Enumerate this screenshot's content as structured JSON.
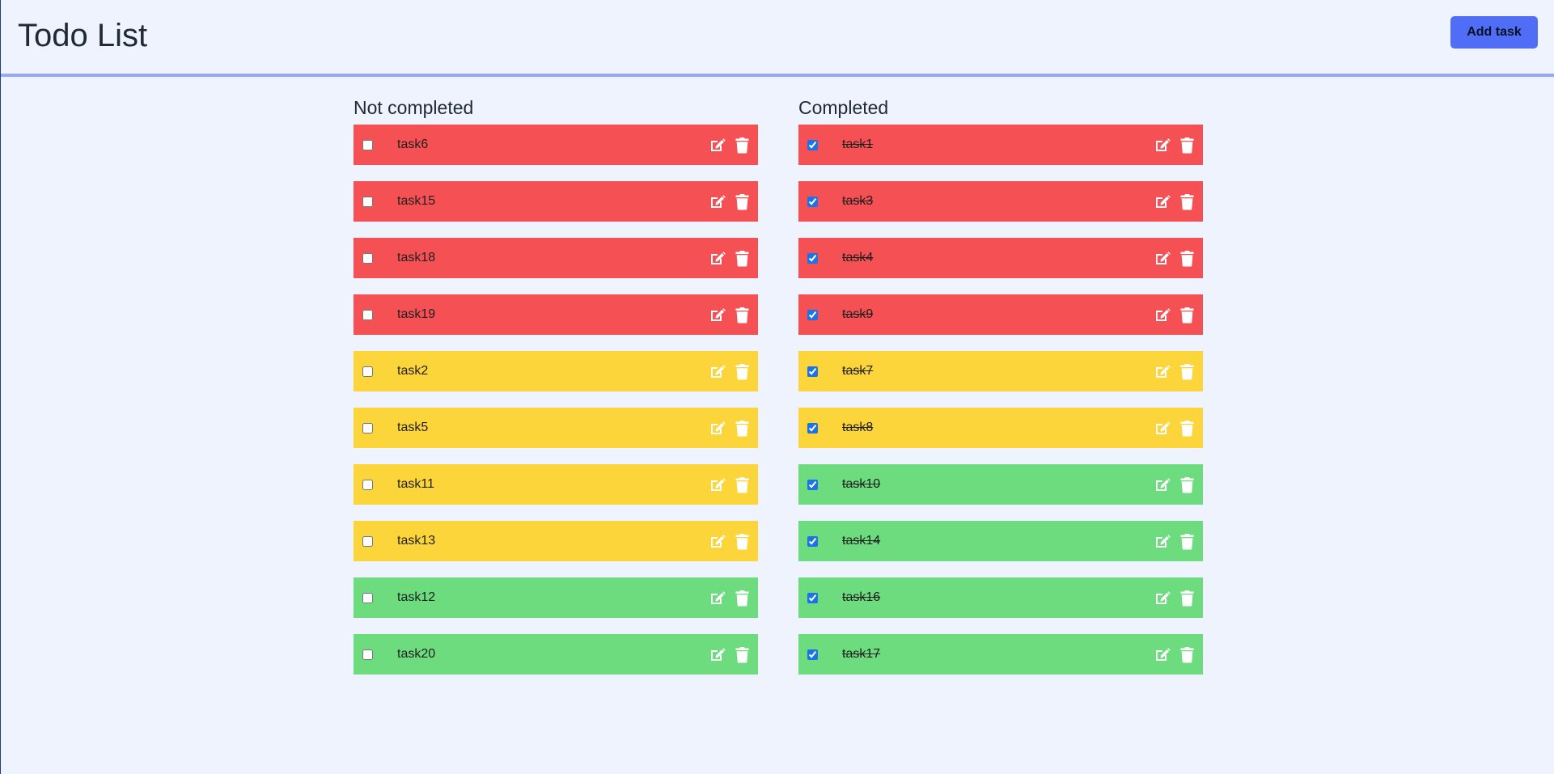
{
  "app": {
    "title": "Todo List",
    "add_button_label": "Add task"
  },
  "colors": {
    "background": "#eef3fe",
    "header_border": "#93abf4",
    "button": "#4f6ef5",
    "priority_high": "#f55154",
    "priority_medium": "#fcd53a",
    "priority_low": "#6cdc7f",
    "icon": "#ffffff"
  },
  "icons": {
    "edit": "edit-icon",
    "delete": "trash-icon"
  },
  "columns": [
    {
      "id": "not-completed",
      "title": "Not completed",
      "tasks": [
        {
          "name": "task6",
          "priority": "high",
          "done": false
        },
        {
          "name": "task15",
          "priority": "high",
          "done": false
        },
        {
          "name": "task18",
          "priority": "high",
          "done": false
        },
        {
          "name": "task19",
          "priority": "high",
          "done": false
        },
        {
          "name": "task2",
          "priority": "medium",
          "done": false
        },
        {
          "name": "task5",
          "priority": "medium",
          "done": false
        },
        {
          "name": "task11",
          "priority": "medium",
          "done": false
        },
        {
          "name": "task13",
          "priority": "medium",
          "done": false
        },
        {
          "name": "task12",
          "priority": "low",
          "done": false
        },
        {
          "name": "task20",
          "priority": "low",
          "done": false
        }
      ]
    },
    {
      "id": "completed",
      "title": "Completed",
      "tasks": [
        {
          "name": "task1",
          "priority": "high",
          "done": true
        },
        {
          "name": "task3",
          "priority": "high",
          "done": true
        },
        {
          "name": "task4",
          "priority": "high",
          "done": true
        },
        {
          "name": "task9",
          "priority": "high",
          "done": true
        },
        {
          "name": "task7",
          "priority": "medium",
          "done": true
        },
        {
          "name": "task8",
          "priority": "medium",
          "done": true
        },
        {
          "name": "task10",
          "priority": "low",
          "done": true
        },
        {
          "name": "task14",
          "priority": "low",
          "done": true
        },
        {
          "name": "task16",
          "priority": "low",
          "done": true
        },
        {
          "name": "task17",
          "priority": "low",
          "done": true
        }
      ]
    }
  ]
}
